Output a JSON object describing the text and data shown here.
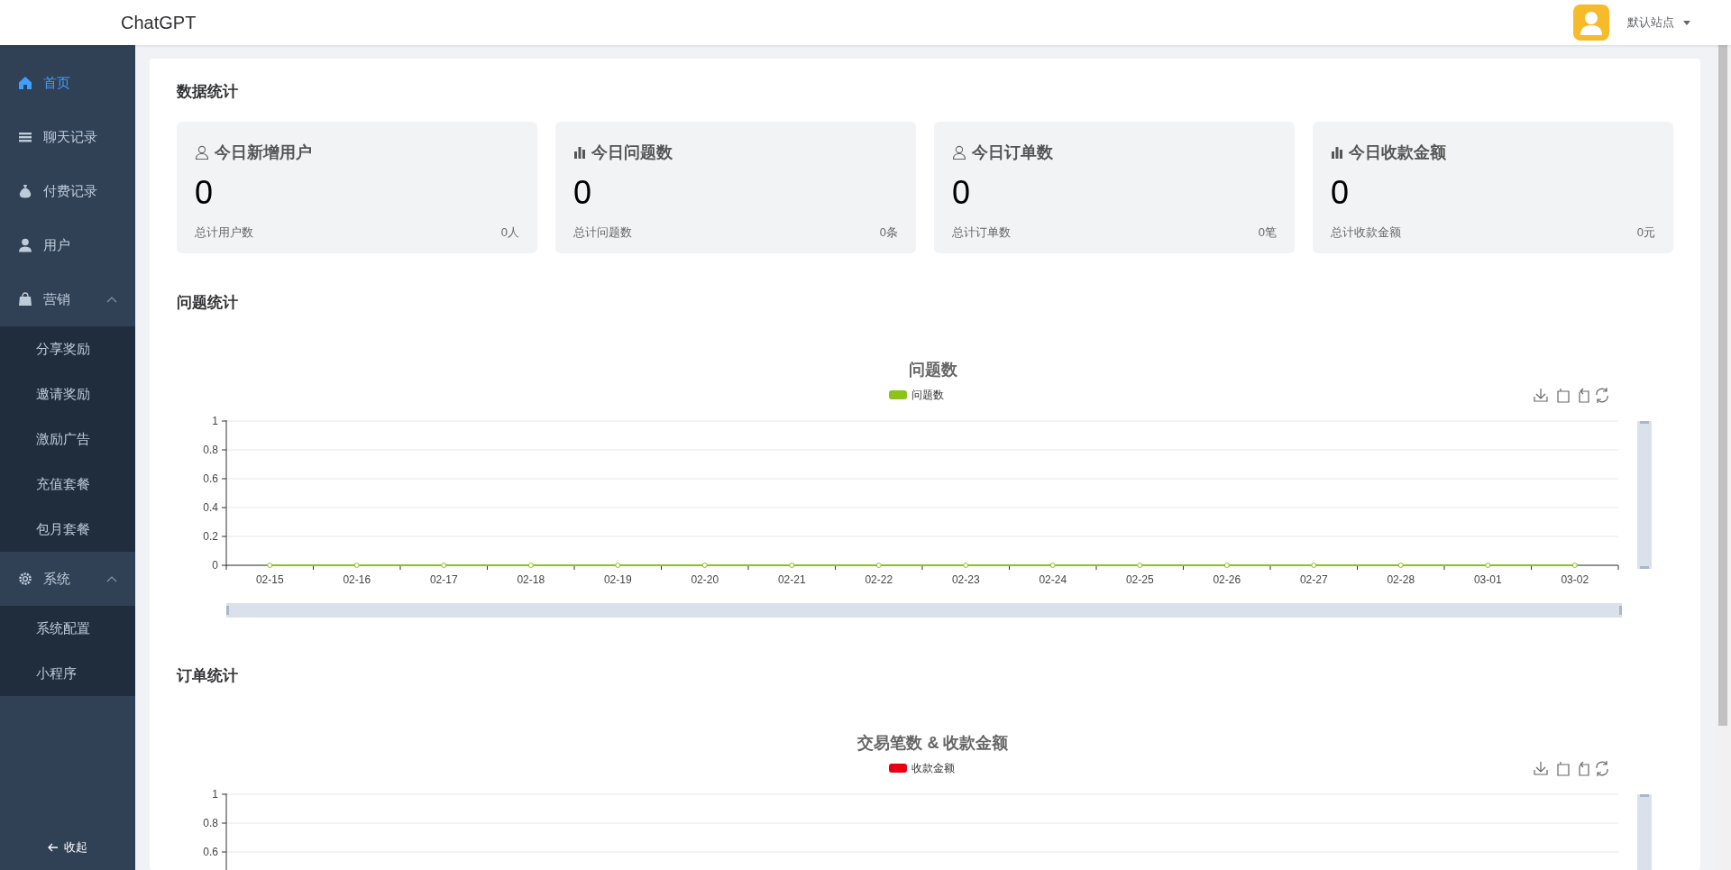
{
  "header": {
    "logo": "ChatGPT",
    "user": "默认站点"
  },
  "sidebar": {
    "items": [
      {
        "label": "首页",
        "selected": true
      },
      {
        "label": "聊天记录",
        "selected": false
      },
      {
        "label": "付费记录",
        "selected": false
      },
      {
        "label": "用户",
        "selected": false
      },
      {
        "label": "营销",
        "selected": false,
        "expanded": true,
        "children": [
          {
            "label": "分享奖励",
            "selected": false
          },
          {
            "label": "邀请奖励",
            "selected": false
          },
          {
            "label": "激励广告",
            "selected": false
          },
          {
            "label": "充值套餐",
            "selected": false
          },
          {
            "label": "包月套餐",
            "selected": false
          }
        ]
      },
      {
        "label": "系统",
        "selected": false,
        "expanded": true,
        "children": [
          {
            "label": "系统配置",
            "selected": false
          },
          {
            "label": "小程序",
            "selected": false
          }
        ]
      }
    ],
    "collapse": "收起"
  },
  "sections": [
    {
      "title": "数据统计"
    },
    {
      "title": "问题统计"
    },
    {
      "title": "订单统计"
    }
  ],
  "stats": [
    {
      "title": "今日新增用户",
      "value": "0",
      "footer_label": "总计用户数",
      "footer_value": "0人"
    },
    {
      "title": "今日问题数",
      "value": "0",
      "footer_label": "总计问题数",
      "footer_value": "0条"
    },
    {
      "title": "今日订单数",
      "value": "0",
      "footer_label": "总计订单数",
      "footer_value": "0笔"
    },
    {
      "title": "今日收款金额",
      "value": "0",
      "footer_label": "总计收款金额",
      "footer_value": "0元"
    }
  ],
  "charts": [
    {
      "chart_data": {
        "type": "line",
        "title": "问题数",
        "categories": [
          "02-15",
          "02-16",
          "02-17",
          "02-18",
          "02-19",
          "02-20",
          "02-21",
          "02-22",
          "02-23",
          "02-24",
          "02-25",
          "02-26",
          "02-27",
          "02-28",
          "03-01",
          "03-02"
        ],
        "series": [
          {
            "name": "问题数",
            "color": "#8cc21a",
            "marker": true,
            "values": [
              0,
              0,
              0,
              0,
              0,
              0,
              0,
              0,
              0,
              0,
              0,
              0,
              0,
              0,
              0,
              0
            ]
          }
        ],
        "ylim": [
          0,
          1
        ],
        "yticks": [
          0,
          0.2,
          0.4,
          0.6,
          0.8,
          1
        ],
        "grid": true
      }
    },
    {
      "chart_data": {
        "type": "line",
        "title": "交易笔数 & 收款金额",
        "series": [
          {
            "name": "收款金额",
            "color": "#e60012"
          }
        ],
        "ylim": [
          0,
          1
        ],
        "yticks": [
          0.6,
          0.8,
          1
        ],
        "grid": true
      }
    }
  ]
}
